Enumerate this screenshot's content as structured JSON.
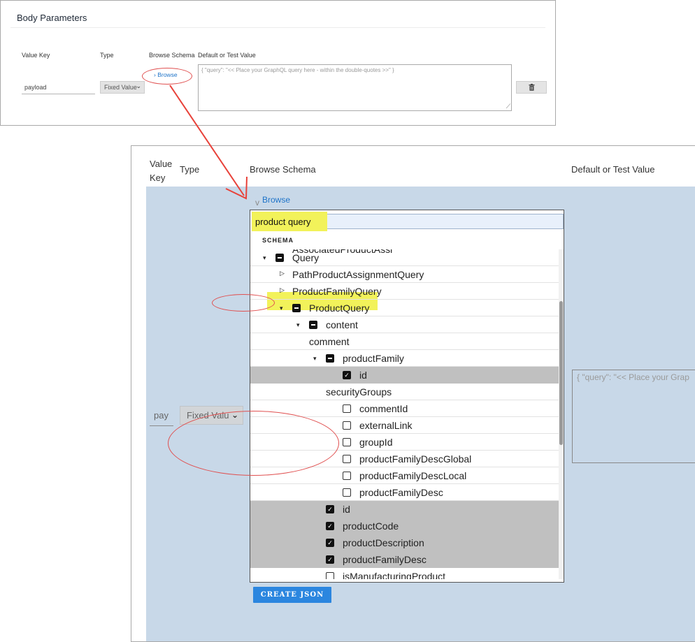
{
  "top_panel": {
    "title": "Body Parameters",
    "headers": {
      "value_key": "Value Key",
      "type": "Type",
      "browse_schema": "Browse Schema",
      "default_value": "Default or Test Value"
    },
    "value_key": "payload",
    "type_value": "Fixed Value",
    "browse_label": "Browse",
    "textarea_placeholder": "{ \"query\": \"<< Place your GraphQL query here - within the double-quotes >>\" }",
    "delete_icon": "trash-icon"
  },
  "bottom_panel": {
    "headers": {
      "value_key_line1": "Value",
      "value_key_line2": "Key",
      "type": "Type",
      "browse_schema": "Browse Schema",
      "default_value": "Default or Test Value"
    },
    "value_key": "pay",
    "type_value": "Fixed Valu",
    "value_placeholder": "{ \"query\": \"<< Place your Grap",
    "browse_label": "Browse",
    "search_value": "product query",
    "schema_label": "SCHEMA",
    "tree_cutoff_text": "AssociatedProductAssi",
    "tree": [
      {
        "label": "Query",
        "toggle": "expanded",
        "check": "partial",
        "selected": false
      },
      {
        "label": "PathProductAssignmentQuery",
        "toggle": "collapsed",
        "check": "none",
        "selected": false
      },
      {
        "label": "ProductFamilyQuery",
        "toggle": "collapsed",
        "check": "none",
        "selected": false
      },
      {
        "label": "ProductQuery",
        "toggle": "expanded",
        "check": "partial",
        "selected": false
      },
      {
        "label": "content",
        "toggle": "expanded",
        "check": "partial",
        "selected": false
      },
      {
        "label": "comment",
        "toggle": "none",
        "check": "none",
        "selected": false
      },
      {
        "label": "productFamily",
        "toggle": "expanded",
        "check": "partial",
        "selected": false
      },
      {
        "label": "id",
        "toggle": "none",
        "check": "checked",
        "selected": true
      },
      {
        "label": "securityGroups",
        "toggle": "none",
        "check": "none",
        "selected": false
      },
      {
        "label": "commentId",
        "toggle": "none",
        "check": "unchecked",
        "selected": false
      },
      {
        "label": "externalLink",
        "toggle": "none",
        "check": "unchecked",
        "selected": false
      },
      {
        "label": "groupId",
        "toggle": "none",
        "check": "unchecked",
        "selected": false
      },
      {
        "label": "productFamilyDescGlobal",
        "toggle": "none",
        "check": "unchecked",
        "selected": false
      },
      {
        "label": "productFamilyDescLocal",
        "toggle": "none",
        "check": "unchecked",
        "selected": false
      },
      {
        "label": "productFamilyDesc",
        "toggle": "none",
        "check": "unchecked",
        "selected": false
      },
      {
        "label": "id",
        "toggle": "none",
        "check": "checked",
        "selected": true
      },
      {
        "label": "productCode",
        "toggle": "none",
        "check": "checked",
        "selected": true
      },
      {
        "label": "productDescription",
        "toggle": "none",
        "check": "checked",
        "selected": true
      },
      {
        "label": "productFamilyDesc",
        "toggle": "none",
        "check": "checked",
        "selected": true
      },
      {
        "label": "isManufacturingProduct",
        "toggle": "none",
        "check": "unchecked",
        "selected": false
      }
    ],
    "create_button": "CREATE JSON"
  },
  "colors": {
    "highlight": "#f2f25a",
    "annotation": "#e05050",
    "panel_blue": "#c8d8e8",
    "link": "#1e73c8",
    "button": "#2b86df",
    "selected_row": "#c0c0c0"
  }
}
